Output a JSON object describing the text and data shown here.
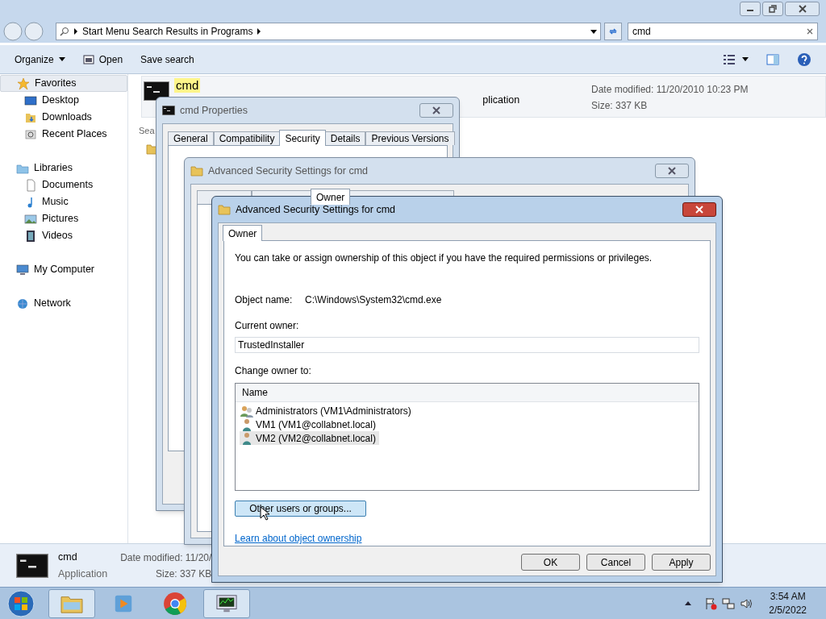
{
  "explorer": {
    "address": {
      "breadcrumb": "Start Menu Search Results in Programs"
    },
    "search": {
      "value": "cmd"
    },
    "toolbar": [
      "Organize",
      "Open",
      "Save search"
    ],
    "nav": [
      {
        "label": "Favorites",
        "kind": "star",
        "selected": true,
        "children": [
          {
            "label": "Desktop",
            "kind": "desktop",
            "selected": false
          },
          {
            "label": "Downloads",
            "kind": "downloads",
            "selected": false
          },
          {
            "label": "Recent Places",
            "kind": "recent",
            "selected": false
          }
        ]
      },
      {
        "label": "Libraries",
        "kind": "library",
        "selected": false,
        "children": [
          {
            "label": "Documents",
            "kind": "document",
            "selected": false
          },
          {
            "label": "Music",
            "kind": "music",
            "selected": false
          },
          {
            "label": "Pictures",
            "kind": "picture",
            "selected": false
          },
          {
            "label": "Videos",
            "kind": "video",
            "selected": false
          }
        ]
      },
      {
        "label": "My Computer",
        "kind": "computer",
        "selected": false
      },
      {
        "label": "Network",
        "kind": "network",
        "selected": false
      }
    ],
    "result": {
      "name": "cmd",
      "type_fragment": "plication",
      "date": "Date modified: 11/20/2010 10:23 PM",
      "size": "Size: 337 KB"
    },
    "section_fragment": "Sea",
    "details_pane": {
      "name": "cmd",
      "type": "Application",
      "date": "Date modified: 11/20/",
      "size": "Size: 337 KB"
    }
  },
  "properties_dialog": {
    "title": "cmd Properties",
    "tabs": [
      {
        "label": "General",
        "selected": false
      },
      {
        "label": "Compatibility",
        "selected": false
      },
      {
        "label": "Security",
        "selected": true
      },
      {
        "label": "Details",
        "selected": false
      },
      {
        "label": "Previous Versions",
        "selected": false
      }
    ]
  },
  "advanced_dialog_back": {
    "title": "Advanced Security Settings for cmd",
    "tabs": [
      {
        "selected": false
      },
      {
        "selected": false
      },
      {
        "label": "Owner",
        "selected": true
      },
      {
        "selected": false
      }
    ]
  },
  "advanced_dialog": {
    "title": "Advanced Security Settings for cmd",
    "tabs": [
      {
        "label": "Owner",
        "selected": true
      }
    ],
    "intro": "You can take or assign ownership of this object if you have the required permissions or privileges.",
    "object_name_label": "Object name:",
    "object_name": "C:\\Windows\\System32\\cmd.exe",
    "current_owner_label": "Current owner:",
    "current_owner": "TrustedInstaller",
    "change_owner_label": "Change owner to:",
    "list_header": "Name",
    "owners": [
      {
        "name": "Administrators (VM1\\Administrators)",
        "kind": "group",
        "selected": false
      },
      {
        "name": "VM1 (VM1@collabnet.local)",
        "kind": "user",
        "selected": false
      },
      {
        "name": "VM2 (VM2@collabnet.local)",
        "kind": "user",
        "selected": true
      }
    ],
    "other_button": "Other users or groups...",
    "link": "Learn about object ownership",
    "buttons": [
      "OK",
      "Cancel",
      "Apply"
    ]
  },
  "taskbar": {
    "apps": [
      {
        "kind": "explorer",
        "active": true
      },
      {
        "kind": "media",
        "active": false
      },
      {
        "kind": "browser",
        "active": false
      },
      {
        "kind": "monitor",
        "active": true
      }
    ],
    "clock": {
      "time": "3:54 AM",
      "date": "2/5/2022"
    }
  }
}
